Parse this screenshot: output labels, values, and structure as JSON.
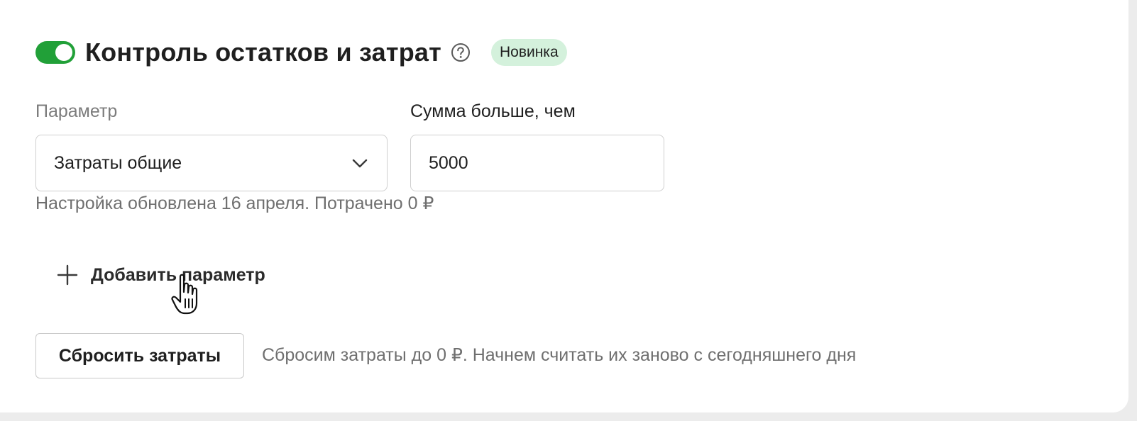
{
  "section": {
    "title": "Контроль остатков и затрат",
    "badge": "Новинка",
    "toggle_on": true,
    "toggle_color": "#21a038",
    "badge_color": "#d4f1dc",
    "help_icon": "question-circle-icon"
  },
  "form": {
    "param_label": "Параметр",
    "param_value": "Затраты общие",
    "sum_label": "Сумма больше, чем",
    "sum_value": "5000",
    "hint": "Настройка обновлена 16 апреля. Потрачено 0 ₽"
  },
  "add_param": {
    "label": "Добавить параметр",
    "icon": "plus-icon"
  },
  "reset": {
    "button_label": "Сбросить затраты",
    "hint": "Сбросим затраты до 0 ₽. Начнем считать их заново с сегодняшнего дня"
  }
}
